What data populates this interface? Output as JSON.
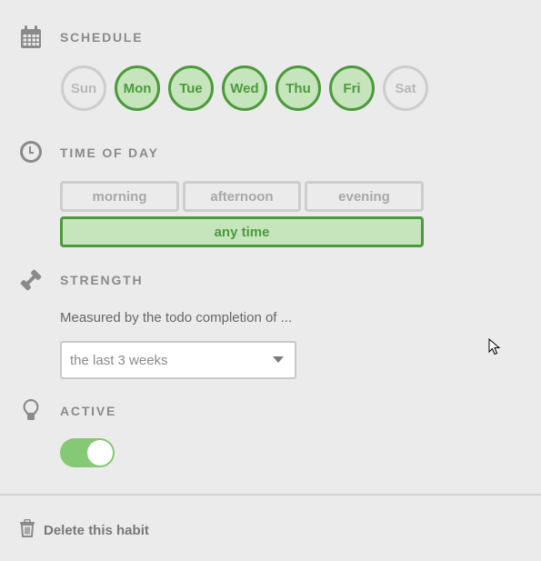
{
  "schedule": {
    "title": "SCHEDULE",
    "icon": "calendar-icon",
    "days": [
      {
        "label": "Sun",
        "selected": false
      },
      {
        "label": "Mon",
        "selected": true
      },
      {
        "label": "Tue",
        "selected": true
      },
      {
        "label": "Wed",
        "selected": true
      },
      {
        "label": "Thu",
        "selected": true
      },
      {
        "label": "Fri",
        "selected": true
      },
      {
        "label": "Sat",
        "selected": false
      }
    ]
  },
  "time_of_day": {
    "title": "TIME OF DAY",
    "icon": "clock-icon",
    "options": [
      {
        "label": "morning",
        "selected": false
      },
      {
        "label": "afternoon",
        "selected": false
      },
      {
        "label": "evening",
        "selected": false
      },
      {
        "label": "any time",
        "selected": true
      }
    ]
  },
  "strength": {
    "title": "STRENGTH",
    "icon": "dumbbell-icon",
    "description": "Measured by the todo completion of ...",
    "select_value": "the last 3 weeks"
  },
  "active": {
    "title": "ACTIVE",
    "icon": "lightbulb-icon",
    "enabled": true
  },
  "footer": {
    "delete_label": "Delete this habit",
    "icon": "trash-icon"
  },
  "colors": {
    "accent": "#4c9a3c",
    "accent_fill": "#c6e5bd",
    "toggle_on": "#85c875",
    "inactive_border": "#cdcdcd",
    "background": "#ebebeb"
  }
}
